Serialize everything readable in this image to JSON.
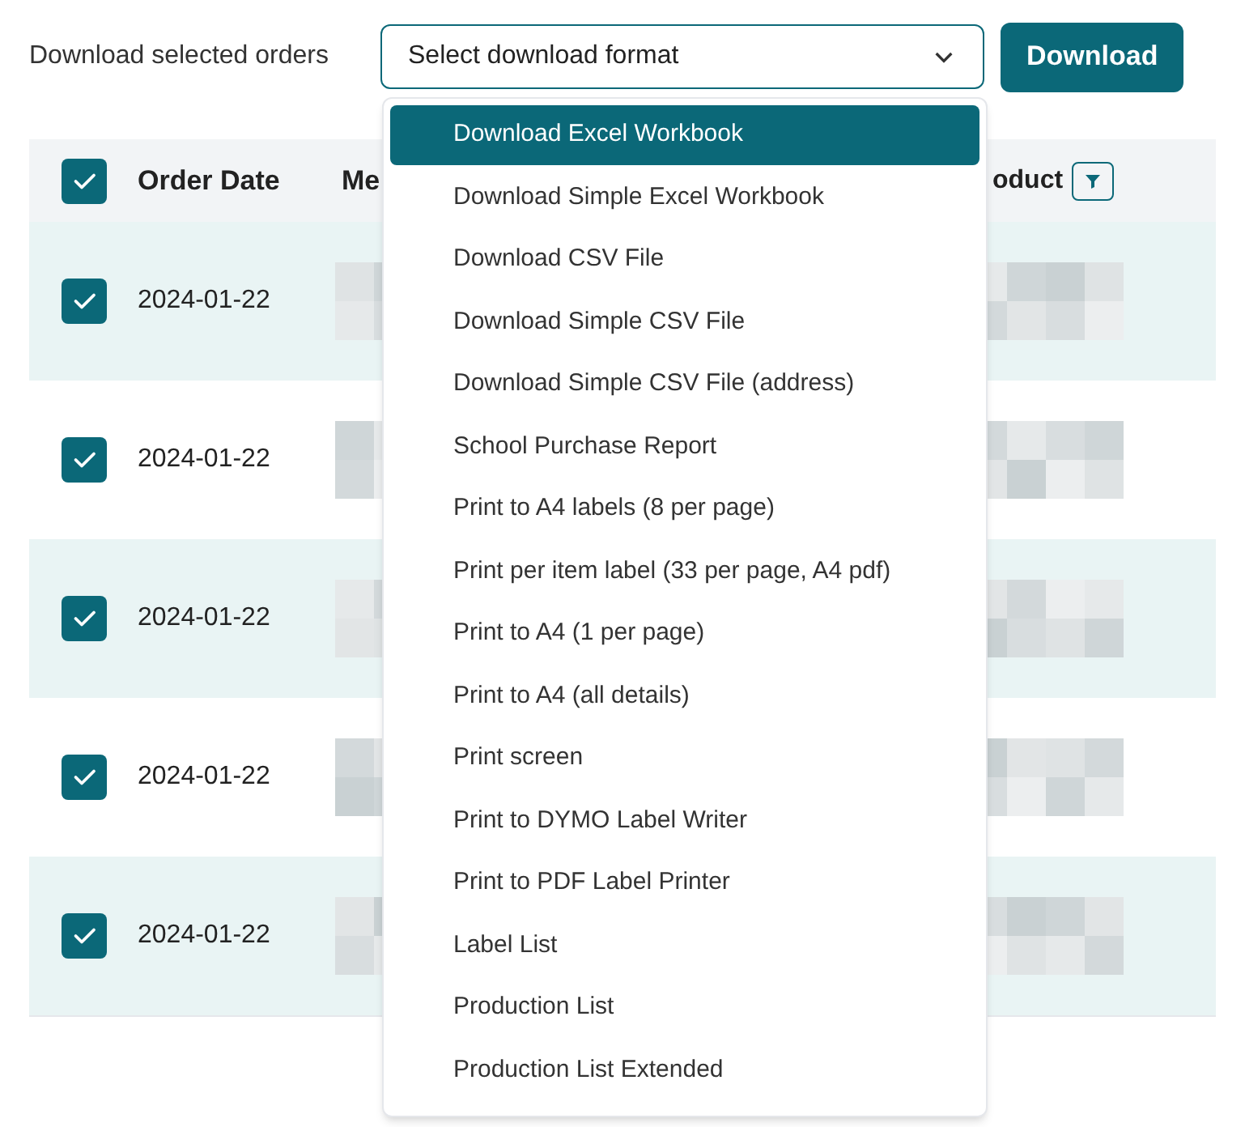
{
  "toolbar": {
    "label": "Download selected orders",
    "select": {
      "placeholder": "Select download format",
      "expanded": true
    },
    "button": "Download"
  },
  "table": {
    "select_all": {
      "checked": true
    },
    "columns": [
      "Order Date",
      "Me",
      "oduct"
    ],
    "rows": [
      {
        "checked": true,
        "order_date": "2024-01-22"
      },
      {
        "checked": true,
        "order_date": "2024-01-22"
      },
      {
        "checked": true,
        "order_date": "2024-01-22"
      },
      {
        "checked": true,
        "order_date": "2024-01-22"
      },
      {
        "checked": true,
        "order_date": "2024-01-22"
      }
    ]
  },
  "menu": {
    "items": [
      {
        "label": "Download Excel Workbook",
        "selected": true
      },
      {
        "label": "Download Simple Excel Workbook",
        "selected": false
      },
      {
        "label": "Download CSV File",
        "selected": false
      },
      {
        "label": "Download Simple CSV File",
        "selected": false
      },
      {
        "label": "Download Simple CSV File (address)",
        "selected": false
      },
      {
        "label": "School Purchase Report",
        "selected": false
      },
      {
        "label": "Print to A4 labels (8 per page)",
        "selected": false
      },
      {
        "label": "Print per item label (33 per page, A4 pdf)",
        "selected": false
      },
      {
        "label": "Print to A4 (1 per page)",
        "selected": false
      },
      {
        "label": "Print to A4 (all details)",
        "selected": false
      },
      {
        "label": "Print screen",
        "selected": false
      },
      {
        "label": "Print to DYMO Label Writer",
        "selected": false
      },
      {
        "label": "Print to PDF Label Printer",
        "selected": false
      },
      {
        "label": "Label List",
        "selected": false
      },
      {
        "label": "Production List",
        "selected": false
      },
      {
        "label": "Production List Extended",
        "selected": false
      }
    ]
  }
}
